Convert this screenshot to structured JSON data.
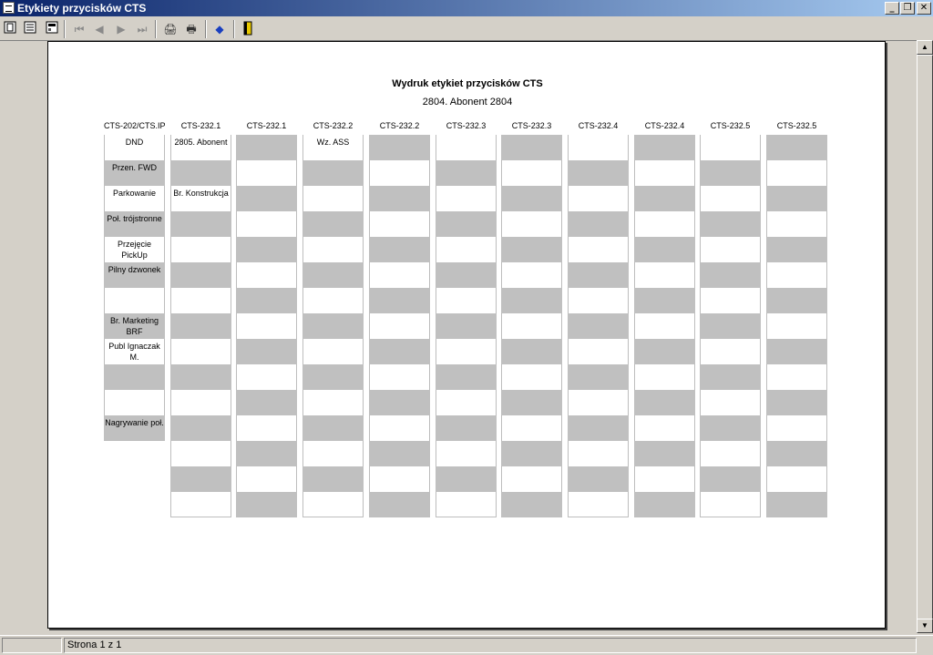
{
  "window": {
    "title": "Etykiety przycisków CTS",
    "minimize": "_",
    "restore": "❐",
    "close": "✕"
  },
  "toolbar": {
    "single_page": "single-page-icon",
    "multi_page": "multi-page-icon",
    "page_setup": "page-setup-icon",
    "first": "⏮",
    "prev": "◀",
    "next": "▶",
    "last": "⏭",
    "print_setup": "🖨",
    "print": "🖶",
    "export": "◆",
    "close": "exit-door-icon"
  },
  "report": {
    "title": "Wydruk etykiet przycisków CTS",
    "subtitle": "2804. Abonent 2804",
    "columns": [
      {
        "header": "CTS-202/CTS.IP",
        "cells": [
          "DND",
          "Przen. FWD",
          "Parkowanie",
          "Poł. trójstronne",
          "Przejęcie PickUp",
          "Pilny dzwonek",
          "",
          "Br. Marketing BRF",
          "Publ Ignaczak M.",
          "",
          "",
          "Nagrywanie poł."
        ]
      },
      {
        "header": "CTS-232.1",
        "cells": [
          "2805. Abonent",
          "",
          "Br. Konstrukcja",
          "",
          "",
          "",
          "",
          "",
          "",
          "",
          "",
          "",
          "",
          "",
          ""
        ]
      },
      {
        "header": "CTS-232.1",
        "cells": [
          "",
          "",
          "",
          "",
          "",
          "",
          "",
          "",
          "",
          "",
          "",
          "",
          "",
          "",
          ""
        ]
      },
      {
        "header": "CTS-232.2",
        "cells": [
          "Wz. ASS",
          "",
          "",
          "",
          "",
          "",
          "",
          "",
          "",
          "",
          "",
          "",
          "",
          "",
          ""
        ]
      },
      {
        "header": "CTS-232.2",
        "cells": [
          "",
          "",
          "",
          "",
          "",
          "",
          "",
          "",
          "",
          "",
          "",
          "",
          "",
          "",
          ""
        ]
      },
      {
        "header": "CTS-232.3",
        "cells": [
          "",
          "",
          "",
          "",
          "",
          "",
          "",
          "",
          "",
          "",
          "",
          "",
          "",
          "",
          ""
        ]
      },
      {
        "header": "CTS-232.3",
        "cells": [
          "",
          "",
          "",
          "",
          "",
          "",
          "",
          "",
          "",
          "",
          "",
          "",
          "",
          "",
          ""
        ]
      },
      {
        "header": "CTS-232.4",
        "cells": [
          "",
          "",
          "",
          "",
          "",
          "",
          "",
          "",
          "",
          "",
          "",
          "",
          "",
          "",
          ""
        ]
      },
      {
        "header": "CTS-232.4",
        "cells": [
          "",
          "",
          "",
          "",
          "",
          "",
          "",
          "",
          "",
          "",
          "",
          "",
          "",
          "",
          ""
        ]
      },
      {
        "header": "CTS-232.5",
        "cells": [
          "",
          "",
          "",
          "",
          "",
          "",
          "",
          "",
          "",
          "",
          "",
          "",
          "",
          "",
          ""
        ]
      },
      {
        "header": "CTS-232.5",
        "cells": [
          "",
          "",
          "",
          "",
          "",
          "",
          "",
          "",
          "",
          "",
          "",
          "",
          "",
          "",
          ""
        ]
      }
    ]
  },
  "status": {
    "page": "Strona 1 z 1"
  },
  "colors": {
    "shaded": "#c0c0c0",
    "title_start": "#0a246a",
    "title_end": "#a6caf0"
  }
}
